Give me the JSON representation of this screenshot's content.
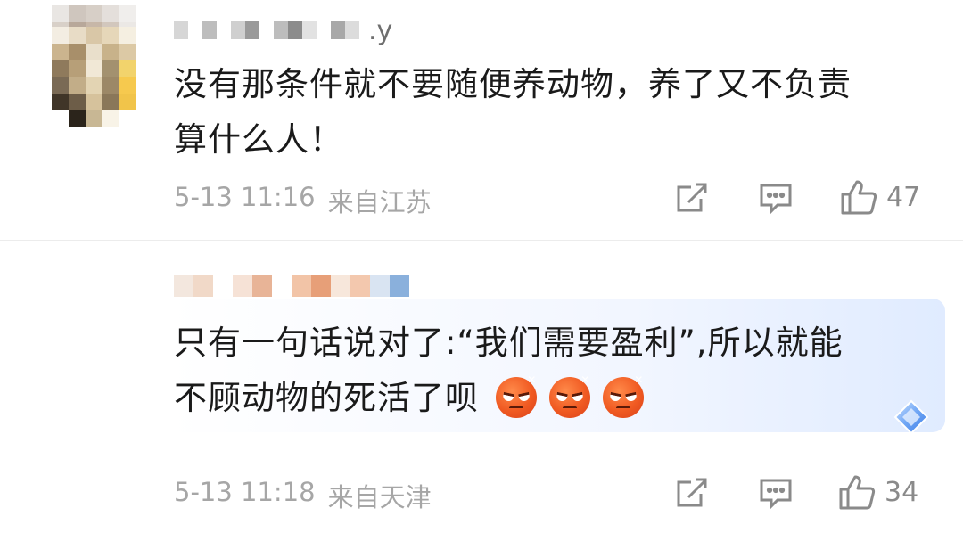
{
  "comments": [
    {
      "username_visible_tail": ".y",
      "content_lines": [
        "没有那条件就不要随便养动物，养了又不负责",
        "算什么人！"
      ],
      "date": "5-13 11:16",
      "location": "来自江苏",
      "likes": "47",
      "avatar_colors": [
        "#e9e6e3",
        "#cfc6be",
        "#d7cfc7",
        "#e4dfdb",
        "#f0eeec",
        "#d8d0c8",
        "#b8a89a",
        "#c7b7a8",
        "#d2c7bd",
        "#ebe8e5",
        "#ccd2d8",
        "#a99a8c",
        "#8e7d70",
        "#b3a79c",
        "#e3e1de",
        "#c5cbd1",
        "#9aa3ad",
        "#3a3230",
        "#5c524d",
        "#d8d6d3",
        "#b1b8bf",
        "#77808a",
        "#1e1a19",
        "#2a2624",
        "#c9c8c6",
        "#ffffff",
        "#ececec",
        "#111111",
        "#1c1c1c",
        "#f4f4f4"
      ],
      "username_mosaic": [
        "#d6d6d6",
        "#ffffff",
        "#bdbdbd",
        "#ffffff",
        "#cfcfcf",
        "#9a9a9a",
        "#ffffff",
        "#bdbdbd",
        "#8c8c8c",
        "#e2e2e2",
        "#ffffff",
        "#a8a8a8",
        "#dcdcdc"
      ]
    },
    {
      "content_lines": [
        "只有一句话说对了:“我们需要盈利”,所以就能",
        "不顾动物的死活了呗"
      ],
      "date": "5-13 11:18",
      "location": "来自天津",
      "likes": "34",
      "avatar_colors": [
        "#f3ede2",
        "#e8dcc6",
        "#d9c7a7",
        "#e6d7b9",
        "#f5efe1",
        "#cbb48e",
        "#a88f6a",
        "#e9dfcb",
        "#c8b28a",
        "#dcc9a5",
        "#8f7a5c",
        "#b79f78",
        "#f1e8d6",
        "#a3916f",
        "#f2d36c",
        "#7a6a55",
        "#c2ad88",
        "#e3d4b3",
        "#9c8867",
        "#f6c94e",
        "#403528",
        "#6d5d48",
        "#d6c29c",
        "#8a7759",
        "#f1c44a",
        "#ffffff",
        "#2b241b",
        "#c8b794",
        "#f8f3e7",
        "#ffffff"
      ],
      "username_mosaic": [
        "#f3e7de",
        "#f1d9c8",
        "#ffffff",
        "#f6e2d6",
        "#e8b497",
        "#ffffff",
        "#f2c4a7",
        "#e79f78",
        "#f7e7db",
        "#f3c8ae",
        "#d9e4f2",
        "#8ab0dc"
      ]
    }
  ],
  "icons": {
    "share": "share-icon",
    "reply": "comment-icon",
    "like": "thumbs-up-icon",
    "emoji": "angry-face-emoji",
    "badge": "diamond-badge-icon"
  }
}
